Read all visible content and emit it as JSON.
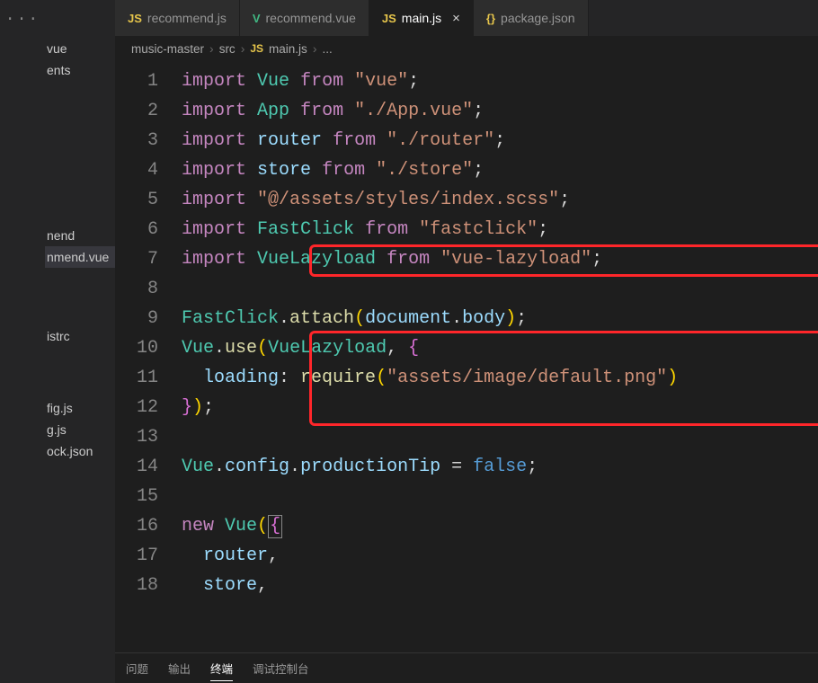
{
  "sidebar_dots": "···",
  "explorer": {
    "items": [
      {
        "label": "vue"
      },
      {
        "label": "ents"
      },
      {
        "label": ""
      },
      {
        "label": ""
      },
      {
        "label": "nend"
      },
      {
        "label": "nmend.vue",
        "selected": true
      },
      {
        "label": ""
      },
      {
        "label": "istrc"
      },
      {
        "label": ""
      },
      {
        "label": "fig.js"
      },
      {
        "label": "g.js"
      },
      {
        "label": "ock.json"
      }
    ]
  },
  "tabs": [
    {
      "icon_type": "js",
      "icon": "JS",
      "label": "recommend.js",
      "active": false
    },
    {
      "icon_type": "vue",
      "icon": "V",
      "label": "recommend.vue",
      "active": false
    },
    {
      "icon_type": "js",
      "icon": "JS",
      "label": "main.js",
      "active": true
    },
    {
      "icon_type": "json",
      "icon": "{}",
      "label": "package.json",
      "active": false
    }
  ],
  "close_glyph": "×",
  "breadcrumb": {
    "parts": [
      "music-master",
      "src",
      "main.js",
      "..."
    ],
    "sep": "›",
    "file_icon": "JS"
  },
  "code": {
    "line_start": 1,
    "line_count": 18,
    "lines": [
      [
        [
          "keyword",
          "import"
        ],
        [
          "plain",
          " "
        ],
        [
          "class",
          "Vue"
        ],
        [
          "plain",
          " "
        ],
        [
          "keyword",
          "from"
        ],
        [
          "plain",
          " "
        ],
        [
          "string",
          "\"vue\""
        ],
        [
          "punct",
          ";"
        ]
      ],
      [
        [
          "keyword",
          "import"
        ],
        [
          "plain",
          " "
        ],
        [
          "class",
          "App"
        ],
        [
          "plain",
          " "
        ],
        [
          "keyword",
          "from"
        ],
        [
          "plain",
          " "
        ],
        [
          "string",
          "\"./App.vue\""
        ],
        [
          "punct",
          ";"
        ]
      ],
      [
        [
          "keyword",
          "import"
        ],
        [
          "plain",
          " "
        ],
        [
          "var",
          "router"
        ],
        [
          "plain",
          " "
        ],
        [
          "keyword",
          "from"
        ],
        [
          "plain",
          " "
        ],
        [
          "string",
          "\"./router\""
        ],
        [
          "punct",
          ";"
        ]
      ],
      [
        [
          "keyword",
          "import"
        ],
        [
          "plain",
          " "
        ],
        [
          "var",
          "store"
        ],
        [
          "plain",
          " "
        ],
        [
          "keyword",
          "from"
        ],
        [
          "plain",
          " "
        ],
        [
          "string",
          "\"./store\""
        ],
        [
          "punct",
          ";"
        ]
      ],
      [
        [
          "keyword",
          "import"
        ],
        [
          "plain",
          " "
        ],
        [
          "string",
          "\"@/assets/styles/index.scss\""
        ],
        [
          "punct",
          ";"
        ]
      ],
      [
        [
          "keyword",
          "import"
        ],
        [
          "plain",
          " "
        ],
        [
          "class",
          "FastClick"
        ],
        [
          "plain",
          " "
        ],
        [
          "keyword",
          "from"
        ],
        [
          "plain",
          " "
        ],
        [
          "string",
          "\"fastclick\""
        ],
        [
          "punct",
          ";"
        ]
      ],
      [
        [
          "keyword",
          "import"
        ],
        [
          "plain",
          " "
        ],
        [
          "class",
          "VueLazyload"
        ],
        [
          "plain",
          " "
        ],
        [
          "keyword",
          "from"
        ],
        [
          "plain",
          " "
        ],
        [
          "string",
          "\"vue-lazyload\""
        ],
        [
          "punct",
          ";"
        ]
      ],
      [],
      [
        [
          "class",
          "FastClick"
        ],
        [
          "punct",
          "."
        ],
        [
          "func",
          "attach"
        ],
        [
          "bracket-y",
          "("
        ],
        [
          "var",
          "document"
        ],
        [
          "punct",
          "."
        ],
        [
          "var",
          "body"
        ],
        [
          "bracket-y",
          ")"
        ],
        [
          "punct",
          ";"
        ]
      ],
      [
        [
          "class",
          "Vue"
        ],
        [
          "punct",
          "."
        ],
        [
          "func",
          "use"
        ],
        [
          "bracket-y",
          "("
        ],
        [
          "class",
          "VueLazyload"
        ],
        [
          "punct",
          ", "
        ],
        [
          "bracket-p",
          "{"
        ]
      ],
      [
        [
          "plain",
          "  "
        ],
        [
          "prop",
          "loading"
        ],
        [
          "punct",
          ": "
        ],
        [
          "func",
          "require"
        ],
        [
          "bracket-y",
          "("
        ],
        [
          "string",
          "\"assets/image/default.png\""
        ],
        [
          "bracket-y",
          ")"
        ]
      ],
      [
        [
          "bracket-p",
          "}"
        ],
        [
          "bracket-y",
          ")"
        ],
        [
          "punct",
          ";"
        ]
      ],
      [],
      [
        [
          "class",
          "Vue"
        ],
        [
          "punct",
          "."
        ],
        [
          "var",
          "config"
        ],
        [
          "punct",
          "."
        ],
        [
          "var",
          "productionTip"
        ],
        [
          "plain",
          " = "
        ],
        [
          "bool",
          "false"
        ],
        [
          "punct",
          ";"
        ]
      ],
      [],
      [
        [
          "keyword",
          "new"
        ],
        [
          "plain",
          " "
        ],
        [
          "class",
          "Vue"
        ],
        [
          "bracket-y",
          "("
        ],
        [
          "cursor-open",
          ""
        ],
        [
          "bracket-p",
          "{"
        ],
        [
          "cursor-close",
          ""
        ]
      ],
      [
        [
          "plain",
          "  "
        ],
        [
          "var",
          "router"
        ],
        [
          "punct",
          ","
        ]
      ],
      [
        [
          "plain",
          "  "
        ],
        [
          "var",
          "store"
        ],
        [
          "punct",
          ","
        ]
      ]
    ]
  },
  "panel": {
    "tabs": [
      "问题",
      "输出",
      "终端",
      "调试控制台"
    ],
    "active_index": 2
  }
}
